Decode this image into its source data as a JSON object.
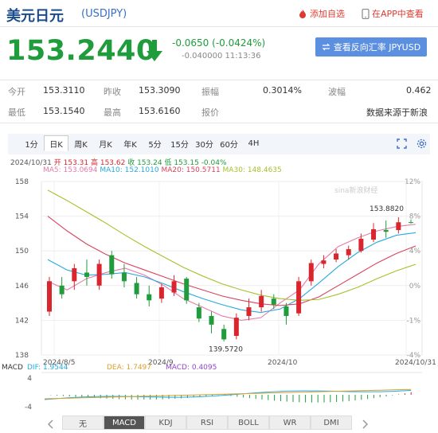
{
  "header": {
    "title": "美元日元",
    "code": "(USDJPY)",
    "favorite_label": "添加自选",
    "app_label": "在APP中查看"
  },
  "quote": {
    "price": "153.2440",
    "change": "-0.0650 (-0.0424%)",
    "sub_change": "-0.040000",
    "time": "11:13:36",
    "button_label": "查看反向汇率 JPYUSD"
  },
  "stats": {
    "row1": [
      {
        "label": "今开",
        "value": "153.3110"
      },
      {
        "label": "昨收",
        "value": "153.3090"
      },
      {
        "label": "振幅",
        "value": "0.3014%"
      },
      {
        "label": "波幅",
        "value": "0.462"
      }
    ],
    "row2": [
      {
        "label": "最低",
        "value": "153.1540"
      },
      {
        "label": "最高",
        "value": "153.6160"
      },
      {
        "label": "报价",
        "value": ""
      },
      {
        "label": "数据来源于新浪",
        "value": ""
      }
    ]
  },
  "tabs": [
    "1分",
    "日K",
    "周K",
    "月K",
    "年K",
    "5分",
    "15分",
    "30分",
    "60分",
    "4H"
  ],
  "active_tab": "日K",
  "info": {
    "date": "2024/10/31",
    "open": "开 153.31",
    "high": "高 153.62",
    "close": "收 153.24",
    "low": "低 153.15",
    "pct": "-0.04%"
  },
  "ma": {
    "ma5": "MA5: 153.0694",
    "ma10": "MA10: 152.1010",
    "ma20": "MA20: 150.5711",
    "ma30": "MA30: 148.4635"
  },
  "colors": {
    "ma5": "#e77aa9",
    "ma10": "#27a9e1",
    "ma20": "#d9435c",
    "ma30": "#a6c12d",
    "up": "#d9262e",
    "down": "#1f9c3b"
  },
  "axis": {
    "y_left": [
      "158",
      "154",
      "150",
      "146",
      "142",
      "138"
    ],
    "y_right": [
      "12%",
      "8%",
      "4%",
      "0%",
      "-1%",
      "-4%"
    ],
    "x": [
      "2024/8/5",
      "2024/9",
      "2024/10",
      "2024/10/31"
    ]
  },
  "annotations": {
    "high": "153.8820",
    "low": "139.5720"
  },
  "watermark": "sina新浪财经",
  "macd": {
    "label": "MACD",
    "dif": "DIF: 1.9544",
    "dea": "DEA: 1.7497",
    "macd": "MACD: 0.4095",
    "y_top": "4",
    "y_bottom": "-4"
  },
  "bottom_tabs": [
    "无",
    "MACD",
    "KDJ",
    "RSI",
    "BOLL",
    "WR",
    "DMI"
  ],
  "bottom_active": "MACD",
  "chart_data": {
    "type": "line",
    "title": "",
    "ylim": [
      138,
      158
    ],
    "x_ticks": [
      "2024/8/5",
      "2024/9",
      "2024/10",
      "2024/10/31"
    ],
    "series": [
      {
        "name": "MA5",
        "values": [
          146.5,
          145.5,
          146.8,
          147.5,
          148,
          147.2,
          146,
          144.5,
          143.5,
          142.5,
          142,
          142.3,
          144,
          145.5,
          148.5,
          150.5,
          151.5,
          152.3,
          152.8,
          153.07
        ]
      },
      {
        "name": "MA10",
        "values": [
          149,
          147.8,
          147.2,
          147.3,
          147.5,
          147,
          146.2,
          145.3,
          144.5,
          143.8,
          143.2,
          142.9,
          143.3,
          144.5,
          146.3,
          148.2,
          149.8,
          151,
          151.8,
          152.1
        ]
      },
      {
        "name": "MA20",
        "values": [
          154,
          152.3,
          150.8,
          149.6,
          148.6,
          147.8,
          147,
          146.2,
          145.5,
          144.8,
          144.3,
          143.9,
          143.7,
          143.9,
          144.7,
          146,
          147.3,
          148.6,
          149.7,
          150.57
        ]
      },
      {
        "name": "MA30",
        "values": [
          157,
          155.8,
          154.5,
          153.2,
          151.8,
          150.5,
          149.3,
          148.1,
          147.1,
          146.2,
          145.5,
          144.9,
          144.5,
          144.3,
          144.4,
          145,
          145.8,
          146.8,
          147.7,
          148.46
        ]
      }
    ],
    "candles": [
      {
        "o": 143,
        "c": 146.5,
        "h": 147,
        "l": 142.5
      },
      {
        "o": 146,
        "c": 145,
        "h": 147,
        "l": 144.5
      },
      {
        "o": 146.5,
        "c": 148,
        "h": 148.5,
        "l": 145.5
      },
      {
        "o": 147.5,
        "c": 147,
        "h": 149,
        "l": 146
      },
      {
        "o": 146,
        "c": 148.5,
        "h": 149,
        "l": 145.5
      },
      {
        "o": 149.5,
        "c": 147.3,
        "h": 150,
        "l": 146.8
      },
      {
        "o": 147.5,
        "c": 146.5,
        "h": 148.5,
        "l": 145.8
      },
      {
        "o": 146.3,
        "c": 145,
        "h": 147,
        "l": 144.5
      },
      {
        "o": 145,
        "c": 144.3,
        "h": 146,
        "l": 143.6
      },
      {
        "o": 144.5,
        "c": 145.8,
        "h": 146.2,
        "l": 144
      },
      {
        "o": 145.2,
        "c": 146.5,
        "h": 147.2,
        "l": 144.8
      },
      {
        "o": 146.8,
        "c": 144.3,
        "h": 147,
        "l": 143.9
      },
      {
        "o": 143.5,
        "c": 142.2,
        "h": 144,
        "l": 141.8
      },
      {
        "o": 142.5,
        "c": 141.5,
        "h": 143,
        "l": 140.5
      },
      {
        "o": 141,
        "c": 139.8,
        "h": 141.5,
        "l": 139.57
      },
      {
        "o": 140.2,
        "c": 142.3,
        "h": 142.8,
        "l": 139.8
      },
      {
        "o": 142.5,
        "c": 143.5,
        "h": 144.5,
        "l": 142
      },
      {
        "o": 143.5,
        "c": 144.8,
        "h": 145.5,
        "l": 143
      },
      {
        "o": 144.5,
        "c": 143.8,
        "h": 145,
        "l": 143.3
      },
      {
        "o": 143.6,
        "c": 142.5,
        "h": 144,
        "l": 141.5
      },
      {
        "o": 142.8,
        "c": 146.5,
        "h": 147,
        "l": 142.5
      },
      {
        "o": 146.5,
        "c": 148.6,
        "h": 149,
        "l": 146
      },
      {
        "o": 148.5,
        "c": 148.9,
        "h": 149.5,
        "l": 148
      },
      {
        "o": 149,
        "c": 149.7,
        "h": 150.2,
        "l": 148.7
      },
      {
        "o": 149.5,
        "c": 150.2,
        "h": 150.6,
        "l": 149
      },
      {
        "o": 150,
        "c": 151.4,
        "h": 152,
        "l": 149.8
      },
      {
        "o": 151.3,
        "c": 152.5,
        "h": 153.2,
        "l": 151
      },
      {
        "o": 152.4,
        "c": 152.2,
        "h": 153.5,
        "l": 151.5
      },
      {
        "o": 152.4,
        "c": 153.3,
        "h": 153.88,
        "l": 152
      },
      {
        "o": 153.31,
        "c": 153.24,
        "h": 153.62,
        "l": 153.15
      }
    ]
  }
}
